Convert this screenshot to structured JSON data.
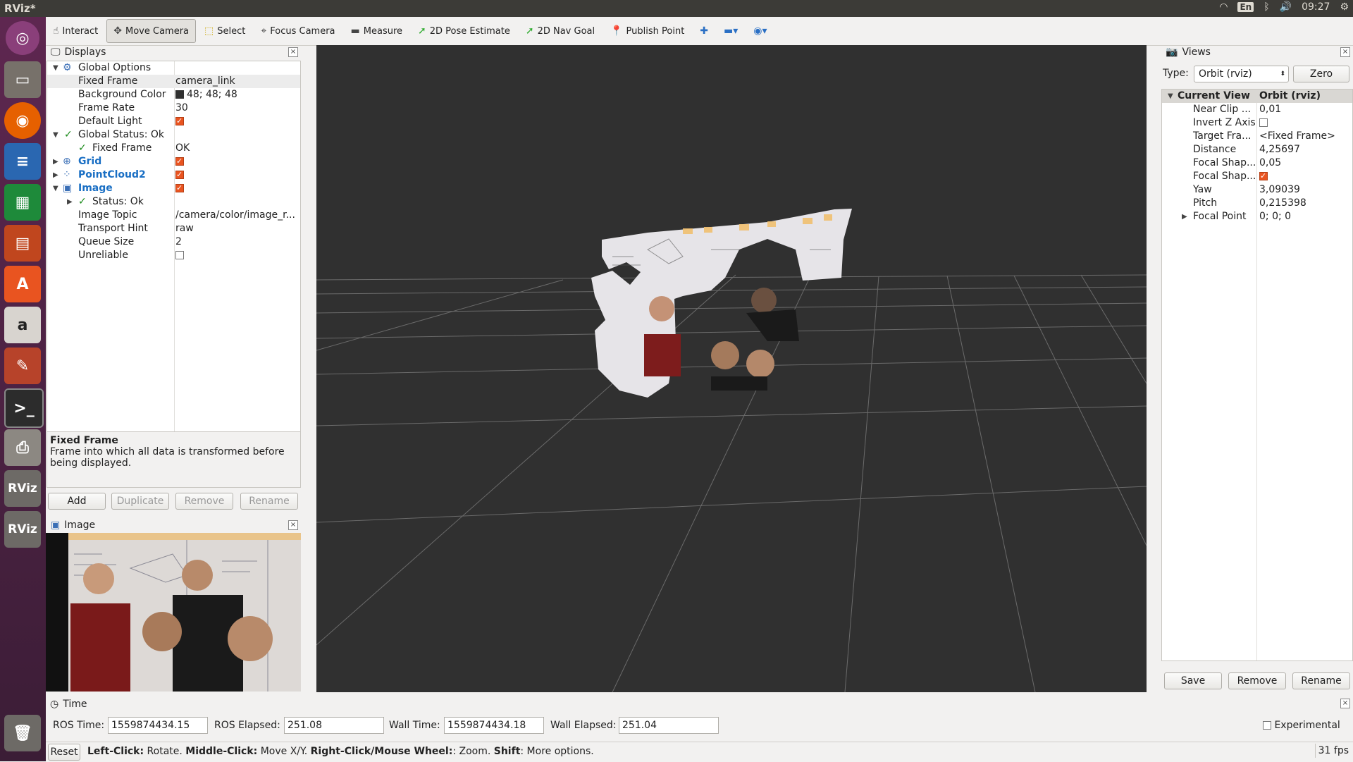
{
  "app": {
    "title": "RViz*",
    "clock": "09:27",
    "lang": "En"
  },
  "toolbar": {
    "items": [
      {
        "label": "Interact",
        "icon": "hand-icon"
      },
      {
        "label": "Move Camera",
        "icon": "move-icon"
      },
      {
        "label": "Select",
        "icon": "select-box-icon"
      },
      {
        "label": "Focus Camera",
        "icon": "crosshair-icon"
      },
      {
        "label": "Measure",
        "icon": "ruler-icon"
      },
      {
        "label": "2D Pose Estimate",
        "icon": "green-arrow-icon"
      },
      {
        "label": "2D Nav Goal",
        "icon": "green-arrow-icon"
      },
      {
        "label": "Publish Point",
        "icon": "pin-icon"
      }
    ]
  },
  "displays": {
    "title": "Displays",
    "rows": [
      {
        "name": "Global Options",
        "value": ""
      },
      {
        "name": "Fixed Frame",
        "value": "camera_link"
      },
      {
        "name": "Background Color",
        "value": "48; 48; 48"
      },
      {
        "name": "Frame Rate",
        "value": "30"
      },
      {
        "name": "Default Light",
        "value": ""
      },
      {
        "name": "Global Status: Ok",
        "value": ""
      },
      {
        "name": "Fixed Frame",
        "value": "OK"
      },
      {
        "name": "Grid",
        "value": ""
      },
      {
        "name": "PointCloud2",
        "value": ""
      },
      {
        "name": "Image",
        "value": ""
      },
      {
        "name": "Status: Ok",
        "value": ""
      },
      {
        "name": "Image Topic",
        "value": "/camera/color/image_r..."
      },
      {
        "name": "Transport Hint",
        "value": "raw"
      },
      {
        "name": "Queue Size",
        "value": "2"
      },
      {
        "name": "Unreliable",
        "value": ""
      }
    ],
    "desc_title": "Fixed Frame",
    "desc_text": "Frame into which all data is transformed before being displayed.",
    "buttons": {
      "add": "Add",
      "duplicate": "Duplicate",
      "remove": "Remove",
      "rename": "Rename"
    }
  },
  "image_panel": {
    "title": "Image"
  },
  "views": {
    "title": "Views",
    "type_label": "Type:",
    "type_value": "Orbit (rviz)",
    "zero": "Zero",
    "header_name": "Current View",
    "header_value": "Orbit (rviz)",
    "rows": [
      {
        "name": "Near Clip ...",
        "value": "0,01"
      },
      {
        "name": "Invert Z Axis",
        "value": ""
      },
      {
        "name": "Target Fra...",
        "value": "<Fixed Frame>"
      },
      {
        "name": "Distance",
        "value": "4,25697"
      },
      {
        "name": "Focal Shap...",
        "value": "0,05"
      },
      {
        "name": "Focal Shap...",
        "value": ""
      },
      {
        "name": "Yaw",
        "value": "3,09039"
      },
      {
        "name": "Pitch",
        "value": "0,215398"
      },
      {
        "name": "Focal Point",
        "value": "0; 0; 0"
      }
    ],
    "buttons": {
      "save": "Save",
      "remove": "Remove",
      "rename": "Rename"
    }
  },
  "time": {
    "title": "Time",
    "ros_time_label": "ROS Time:",
    "ros_time": "1559874434.15",
    "ros_elapsed_label": "ROS Elapsed:",
    "ros_elapsed": "251.08",
    "wall_time_label": "Wall Time:",
    "wall_time": "1559874434.18",
    "wall_elapsed_label": "Wall Elapsed:",
    "wall_elapsed": "251.04",
    "experimental": "Experimental"
  },
  "status": {
    "reset": "Reset",
    "b1": "Left-Click:",
    "t1": " Rotate. ",
    "b2": "Middle-Click:",
    "t2": " Move X/Y. ",
    "b3": "Right-Click/Mouse Wheel:",
    "t3": ": Zoom. ",
    "b4": "Shift",
    "t4": ": More options.",
    "fps": "31 fps"
  },
  "launcher": {
    "rviz1": "RViz",
    "rviz2": "RViz",
    "amazon": "a"
  }
}
